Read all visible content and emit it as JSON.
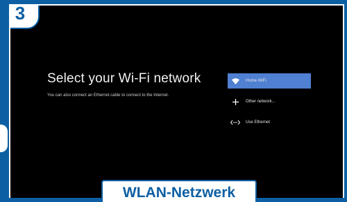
{
  "step_number": "3",
  "screen": {
    "title": "Select your Wi-Fi network",
    "subtitle": "You can also connect an Ethernet cable to connect to the Internet.",
    "networks": [
      {
        "label": "Home WiFi",
        "icon": "wifi-icon",
        "selected": true
      },
      {
        "label": "Other network...",
        "icon": "plus-icon",
        "selected": false
      },
      {
        "label": "Use Ethernet",
        "icon": "ethernet-icon",
        "selected": false
      }
    ]
  },
  "caption": "WLAN-Netzwerk",
  "colors": {
    "frame_blue": "#0d5fa3",
    "selected_item": "#4f80d2",
    "screen_bg": "#000000"
  }
}
